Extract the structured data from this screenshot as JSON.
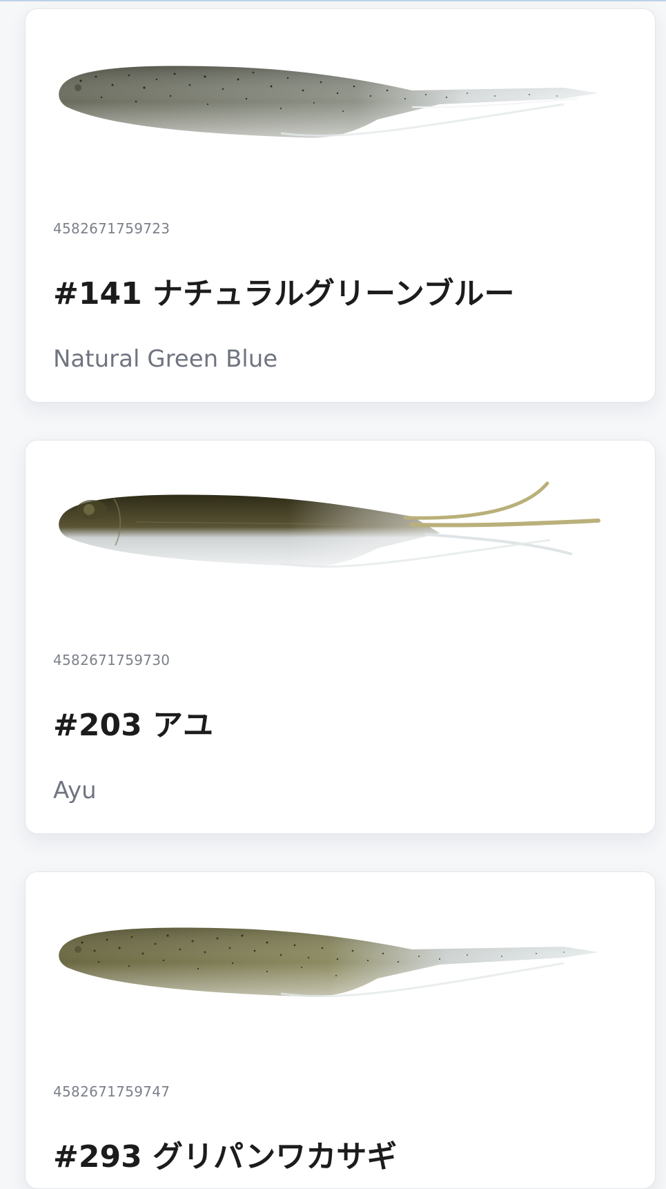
{
  "products": [
    {
      "jan": "4582671759723",
      "name_ja": "#141 ナチュラルグリーンブルー",
      "name_en": "Natural Green Blue",
      "lure_icon": "lure-natural-green-blue",
      "colors": {
        "back": "#5e6152",
        "belly": "#dcdfe0",
        "tail": "#eef1f2",
        "speckle": "#1e211c"
      }
    },
    {
      "jan": "4582671759730",
      "name_ja": "#203 アユ",
      "name_en": "Ayu",
      "lure_icon": "lure-ayu",
      "colors": {
        "back": "#3a3620",
        "belly": "#e3e6e8",
        "tail": "#b9b07a",
        "speckle": "none"
      }
    },
    {
      "jan": "4582671759747",
      "name_ja": "#293 グリパンワカサギ",
      "name_en": "",
      "lure_icon": "lure-green-pumpkin-wakasagi",
      "colors": {
        "back": "#6b6a45",
        "belly": "#d9dcdc",
        "tail": "#e9eeef",
        "speckle": "#2a2a1c"
      }
    }
  ]
}
